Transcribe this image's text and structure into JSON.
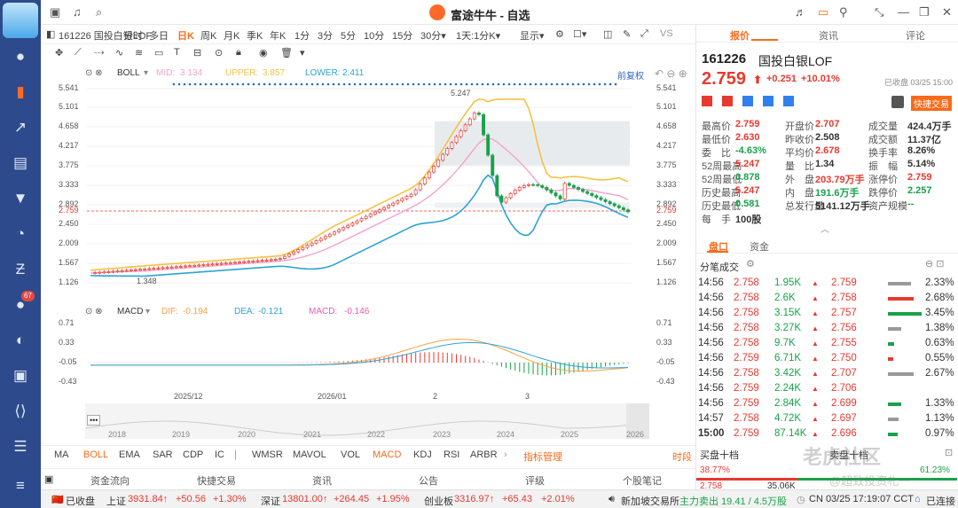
{
  "app": {
    "title": "富途牛牛 - 自选"
  },
  "sidebar": {
    "badge": "67",
    "icons": [
      "avatar-icon",
      "chart-icon",
      "trend-icon",
      "market-icon",
      "filter-icon",
      "pie-icon",
      "zigzag-icon",
      "message-icon",
      "circle-icon",
      "game-icon",
      "code-icon",
      "doc-icon",
      "menu-icon"
    ]
  },
  "toolbar": {
    "stock": "161226 国投白银LOF",
    "timeframes": [
      "分时",
      "多日",
      "日K",
      "周K",
      "月K",
      "季K",
      "年K",
      "1分",
      "3分",
      "5分",
      "10分",
      "15分",
      "30分▾",
      "1天:1分K▾",
      "显示▾"
    ],
    "selected": "日K",
    "vs": "VS"
  },
  "indicator": {
    "name": "BOLL",
    "mid_label": "MID:",
    "mid": "3.134",
    "upper_label": "UPPER:",
    "upper": "3.857",
    "lower_label": "LOWER:",
    "lower": "2.411",
    "fuquan": "前复权"
  },
  "macd": {
    "name": "MACD",
    "dif_label": "DIF:",
    "dif": "-0.194",
    "dea_label": "DEA:",
    "dea": "-0.121",
    "macd_label": "MACD:",
    "macd": "-0.146"
  },
  "axis": {
    "price": [
      "5.541",
      "5.101",
      "4.658",
      "4.217",
      "3.775",
      "3.333",
      "2.892",
      "2.759",
      "2.450",
      "2.009",
      "1.567",
      "1.126"
    ],
    "macd": [
      "0.71",
      "0.33",
      "-0.05",
      "-0.43"
    ],
    "dates": [
      "2025/12",
      "2026/01",
      "2",
      "3"
    ],
    "years": [
      "2018",
      "2019",
      "2020",
      "2021",
      "2022",
      "2023",
      "2024",
      "2025",
      "2026"
    ],
    "high_mark": "5.247",
    "low_mark": "1.348"
  },
  "bottom_tabs": [
    "MA",
    "BOLL",
    "EMA",
    "SAR",
    "CDP",
    "IC",
    "WMSR",
    "MAVOL",
    "VOL",
    "MACD",
    "KDJ",
    "RSI",
    "ARBR",
    "指标管理",
    "时段"
  ],
  "bottom_nav": [
    "资金流向",
    "快捷交易",
    "资讯",
    "公告",
    "评级",
    "个股笔记"
  ],
  "status": {
    "closed": "已收盘",
    "sh_label": "上证",
    "sh": "3931.84↑",
    "sh_chg": "+50.56",
    "sh_pct": "+1.30%",
    "sz_label": "深证",
    "sz": "13801.00↑",
    "sz_chg": "+264.45",
    "sz_pct": "+1.95%",
    "cy_label": "创业板",
    "cy": "3316.97↑",
    "cy_chg": "+65.43",
    "cy_pct": "+2.01%",
    "news": "新加坡交易所",
    "flow": "主力卖出 19.41 / 4.5万股",
    "time": "CN 03/25 17:19:07 CCT",
    "conn": "已连接"
  },
  "right": {
    "tabs": [
      "报价",
      "资讯",
      "评论"
    ],
    "code": "161226",
    "name": "国投白银LOF",
    "price": "2.759",
    "change": "+0.251",
    "pct": "+10.01%",
    "closed_time": "已收盘 03/25 15:00",
    "quick_trade": "快捷交易",
    "quotes": [
      [
        "最高价",
        "2.759",
        "开盘价",
        "2.707",
        "成交量",
        "424.4万手"
      ],
      [
        "最低价",
        "2.630",
        "昨收价",
        "2.508",
        "成交额",
        "11.37亿"
      ],
      [
        "委　比",
        "-4.63%",
        "平均价",
        "2.678",
        "换手率",
        "8.26%"
      ],
      [
        "52周最高",
        "5.247",
        "量　比",
        "1.34",
        "振　幅",
        "5.14%"
      ],
      [
        "52周最低",
        "0.878",
        "外　盘",
        "203.79万手",
        "涨停价",
        "2.759"
      ],
      [
        "历史最高",
        "5.247",
        "内　盘",
        "191.6万手",
        "跌停价",
        "2.257"
      ],
      [
        "历史最低",
        "0.581",
        "总发行量",
        "5141.12万手",
        "资产规模",
        "--"
      ],
      [
        "每　手",
        "100股",
        "",
        "",
        "",
        ""
      ]
    ],
    "subtabs": [
      "盘口",
      "资金"
    ],
    "ticks_title": "分笔成交",
    "ticks": [
      [
        "14:56",
        "2.758",
        "1.95K",
        "2.759",
        "2.33%"
      ],
      [
        "14:56",
        "2.758",
        "2.6K",
        "2.758",
        "2.68%"
      ],
      [
        "14:56",
        "2.758",
        "3.15K",
        "2.757",
        "3.45%"
      ],
      [
        "14:56",
        "2.758",
        "3.27K",
        "2.756",
        "1.38%"
      ],
      [
        "14:56",
        "2.758",
        "9.7K",
        "2.755",
        "0.63%"
      ],
      [
        "14:56",
        "2.759",
        "6.71K",
        "2.750",
        "0.55%"
      ],
      [
        "14:56",
        "2.758",
        "3.42K",
        "2.707",
        "2.67%"
      ],
      [
        "14:56",
        "2.759",
        "2.24K",
        "2.706",
        ""
      ],
      [
        "14:56",
        "2.759",
        "2.84K",
        "2.699",
        "1.33%"
      ],
      [
        "14:57",
        "2.758",
        "4.72K",
        "2.697",
        "1.13%"
      ],
      [
        "15:00",
        "2.759",
        "87.14K",
        "2.696",
        "0.97%"
      ]
    ],
    "buy_title": "买盘十档",
    "sell_title": "卖盘十档",
    "buy_pct": "38.77%",
    "sell_pct": "61.23%",
    "last_price": "2.758",
    "last_vol": "35.06K",
    "watermark": "老虎社区",
    "watermark2": "@超致投资札一"
  },
  "chart_data": {
    "type": "candlestick",
    "title": "161226 国投白银LOF 日K",
    "price_range": [
      1.126,
      5.541
    ],
    "last_close": 2.759,
    "high": 5.247,
    "low": 1.348,
    "indicators": [
      "BOLL",
      "MACD"
    ]
  },
  "colors": {
    "up": "#e8392f",
    "down": "#1aa14a",
    "accent": "#fa6a18",
    "sidebar": "#2d4a8c"
  }
}
